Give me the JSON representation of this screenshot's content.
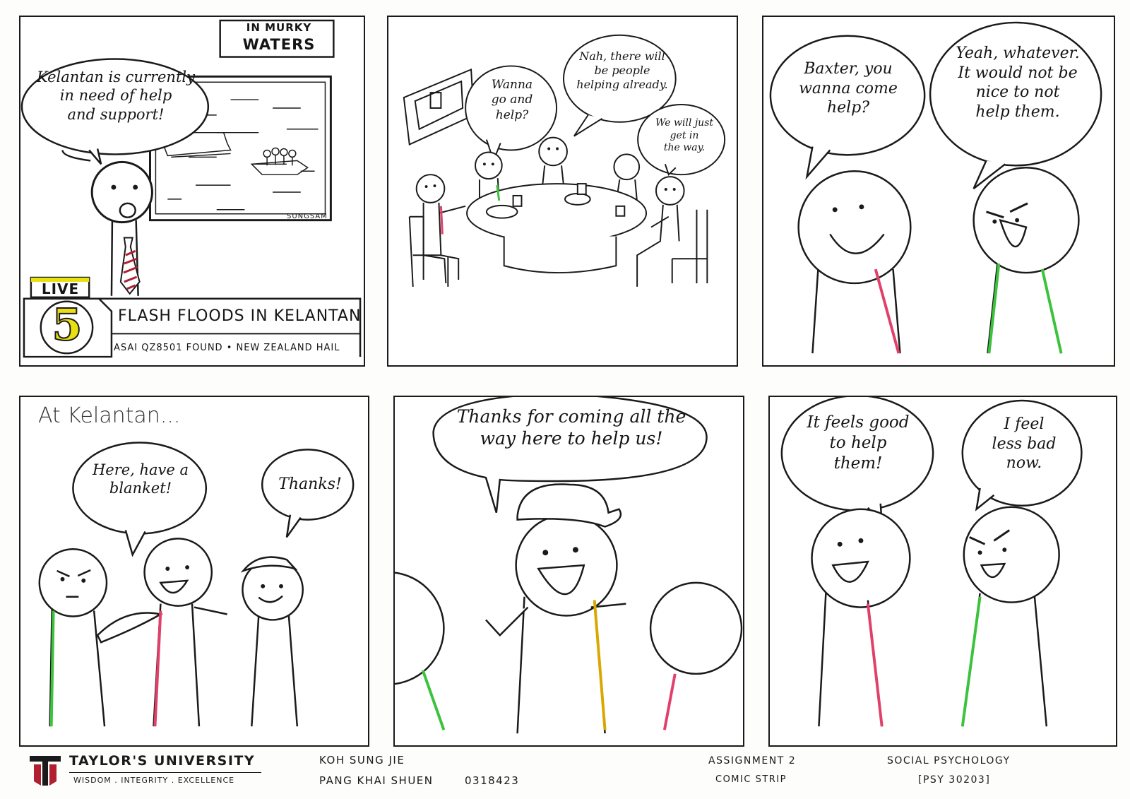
{
  "panels": {
    "p1": {
      "show_title_small": "IN MURKY",
      "show_title_big": "WATERS",
      "bubble": "Kelantan is currently\nin need of help\nand support!",
      "live_label": "LIVE",
      "channel_number": "5",
      "headline": "FLASH FLOODS IN KELANTAN",
      "ticker": "ASAI QZ8501 FOUND  •  NEW ZEALAND HAIL",
      "screen_signature": "SUNGSAM"
    },
    "p2": {
      "bubble_left": "Wanna\ngo and\nhelp?",
      "bubble_top": "Nah, there will\nbe people\nhelping already.",
      "bubble_right": "We will just\nget in\nthe way."
    },
    "p3": {
      "bubble_left": "Baxter, you\nwanna come\nhelp?",
      "bubble_right": "Yeah, whatever.\nIt would not be\nnice to not\nhelp them."
    },
    "p4": {
      "caption": "At Kelantan...",
      "bubble_left": "Here, have a\nblanket!",
      "bubble_right": "Thanks!"
    },
    "p5": {
      "bubble": "Thanks for coming all the\nway here to help us!"
    },
    "p6": {
      "bubble_left": "It feels good\nto help\nthem!",
      "bubble_right": "I feel\nless bad\nnow."
    }
  },
  "footer": {
    "university_name": "TAYLOR'S UNIVERSITY",
    "motto": "WISDOM . INTEGRITY . EXCELLENCE",
    "author_1": "KOH SUNG JIE",
    "author_2": "PANG KHAI SHUEN",
    "student_id": "0318423",
    "assignment_line1": "ASSIGNMENT 2",
    "assignment_line2": "COMIC STRIP",
    "course_line1": "SOCIAL PSYCHOLOGY",
    "course_line2": "[PSY 30203]"
  },
  "colors": {
    "ink": "#1a1a1a",
    "pink": "#e0406a",
    "green": "#3cc23c",
    "yellow": "#e8e010",
    "gold": "#d9a800",
    "tie_red": "#b02030"
  }
}
